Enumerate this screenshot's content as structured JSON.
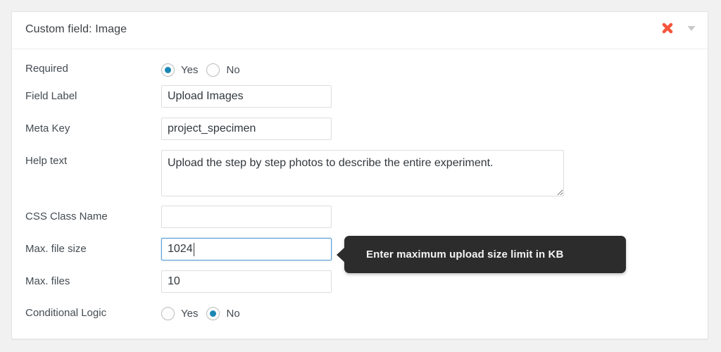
{
  "panel": {
    "title": "Custom field: Image",
    "actions": {
      "delete_icon": "close-x-icon",
      "collapse_icon": "chevron-down-icon"
    }
  },
  "colors": {
    "page_background": "#f1f1f1",
    "panel_background": "#ffffff",
    "panel_border": "#e3e3e3",
    "label_text": "#444b52",
    "input_border": "#dddddd",
    "input_focus_border": "#5b9dd9",
    "radio_selected": "#1b86b4",
    "delete_icon": "#f4553d",
    "collapse_icon": "#c8c8c8",
    "tooltip_background": "#2c2c2c",
    "tooltip_text": "#f4f4f4"
  },
  "fields": {
    "required": {
      "label": "Required",
      "type": "radio",
      "options": [
        "Yes",
        "No"
      ],
      "selected": "Yes"
    },
    "field_label": {
      "label": "Field Label",
      "type": "text",
      "value": "Upload Images",
      "placeholder": ""
    },
    "meta_key": {
      "label": "Meta Key",
      "type": "text",
      "value": "project_specimen",
      "placeholder": ""
    },
    "help_text": {
      "label": "Help text",
      "type": "textarea",
      "value": "Upload the step by step photos to describe the entire experiment.",
      "placeholder": ""
    },
    "css_class_name": {
      "label": "CSS Class Name",
      "type": "text",
      "value": "",
      "placeholder": ""
    },
    "max_file_size": {
      "label": "Max. file size",
      "type": "text",
      "value": "1024",
      "placeholder": "",
      "focused": true
    },
    "max_files": {
      "label": "Max. files",
      "type": "text",
      "value": "10",
      "placeholder": ""
    },
    "conditional_logic": {
      "label": "Conditional Logic",
      "type": "radio",
      "options": [
        "Yes",
        "No"
      ],
      "selected": "No"
    }
  },
  "tooltip": {
    "text": "Enter maximum upload size limit in KB"
  }
}
